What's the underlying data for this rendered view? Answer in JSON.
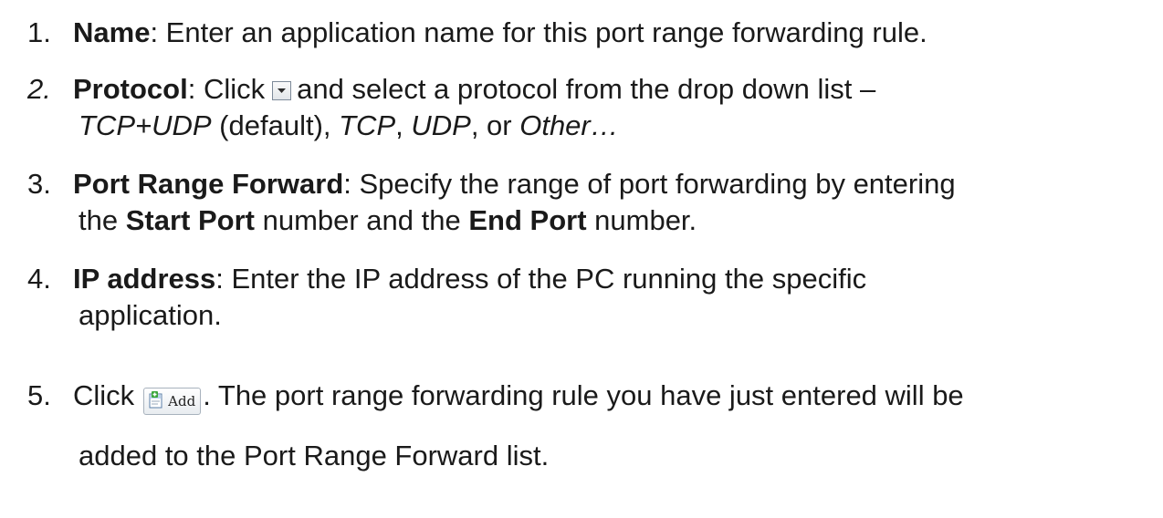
{
  "steps": [
    {
      "num": "1.",
      "bold": "Name",
      "text": ": Enter an application name for this port range forwarding rule."
    },
    {
      "num": "2.",
      "bold": "Protocol",
      "pre_icon": ": Click",
      "post_icon": "and select a protocol from the drop down list –",
      "opt1": "TCP+UDP",
      "opt1_suffix": " (default), ",
      "opt2": "TCP",
      "sep2": ", ",
      "opt3": "UDP",
      "sep3": ", or ",
      "opt4": "Other…"
    },
    {
      "num": "3.",
      "bold": "Port Range Forward",
      "text": ": Specify the range of port forwarding by entering",
      "line2_a": "the ",
      "line2_bold1": "Start Port",
      "line2_b": " number and the ",
      "line2_bold2": "End Port",
      "line2_c": " number."
    },
    {
      "num": "4.",
      "bold": "IP address",
      "text": ": Enter the IP address of the PC running the specific",
      "line2": "application."
    },
    {
      "num": "5.",
      "pre": "Click",
      "button_label": "Add",
      "post": ". The port range forwarding rule you have just entered will be",
      "line2": "added to the Port Range Forward list."
    }
  ],
  "icons": {
    "dropdown": "dropdown-arrow-icon",
    "add": "add-document-icon"
  }
}
